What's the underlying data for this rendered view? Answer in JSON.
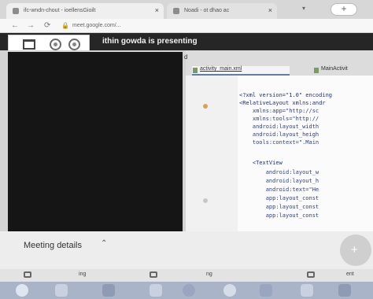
{
  "browser": {
    "tabs": [
      {
        "label": "ifc-wndn-chout - ioellensGioilt"
      },
      {
        "label": "Noadi - ot dhao ac"
      }
    ],
    "new_tab_symbol": "+",
    "close_symbol": "×",
    "nav": {
      "back": "←",
      "forward": "→",
      "reload": "⟳"
    },
    "url": "meet.google.com/..."
  },
  "meeting": {
    "banner_text": "ithin gowda is presenting",
    "details_label": "Meeting details",
    "details_chevron": "⌃",
    "fab_symbol": "+",
    "toolbar_labels": [
      "ing",
      "ng",
      "ent"
    ]
  },
  "editor": {
    "crumb": "d",
    "tabs": [
      {
        "label": "activity_main.xml",
        "active": true
      },
      {
        "label": "MainActivit",
        "active": false
      }
    ],
    "code_lines": [
      "<?xml version=\"1.0\" encoding",
      "<RelativeLayout xmlns:andr",
      "    xmlns:app=\"http://sc",
      "    xmlns:tools=\"http://",
      "    android:layout_width",
      "    android:layout_heigh",
      "    tools:context=\".Main",
      "",
      "    <TextView",
      "        android:layout_w",
      "        android:layout_h",
      "        android:text=\"He",
      "        app:layout_const",
      "        app:layout_const",
      "        app:layout_const"
    ]
  },
  "colors": {
    "banner": "#262626",
    "video": "#151515",
    "taskbar": "#aab4c8",
    "code_text": "#2f3f8f"
  }
}
